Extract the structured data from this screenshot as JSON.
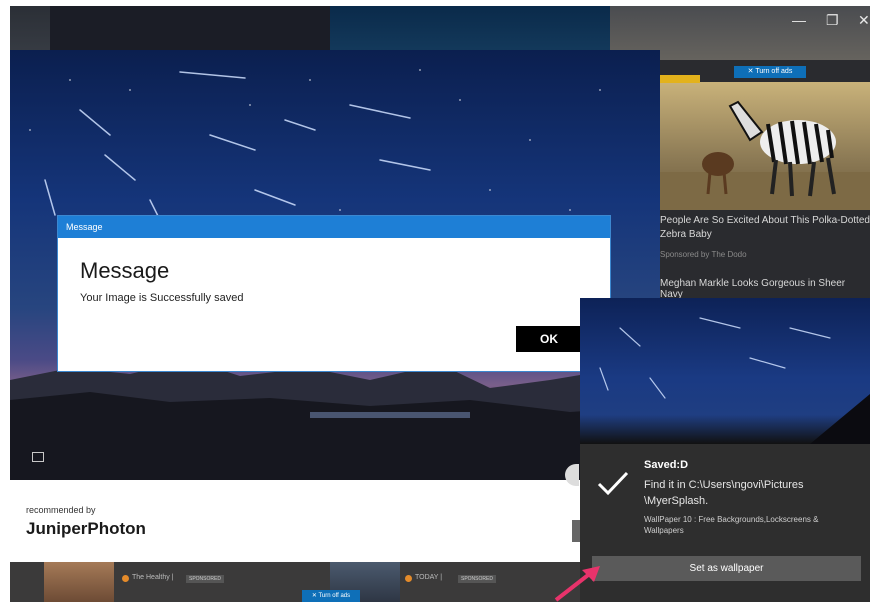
{
  "window": {
    "minimize_glyph": "—",
    "restore_glyph": "❐",
    "close_glyph": "✕"
  },
  "ads": {
    "turn_off_label": "✕ Turn off ads",
    "story1_title": "People Are So Excited About This Polka-Dotted Zebra Baby",
    "story1_sponsor": "Sponsored by The Dodo",
    "story2_title": "Meghan Markle Looks Gorgeous in Sheer Navy",
    "bottom_source1": "The Healthy |",
    "bottom_source2": "TODAY |",
    "sponsored_chip": "SPONSORED",
    "bottom_turn_off": "✕ Turn off ads"
  },
  "recommendation": {
    "by_label": "recommended by",
    "brand": "JuniperPhoton"
  },
  "dialog": {
    "bar_title": "Message",
    "heading": "Message",
    "body": "Your Image is Successfully saved",
    "ok_label": "OK"
  },
  "toast": {
    "check_icon": "checkmark-icon",
    "saved_label": "Saved:D",
    "path_text": "Find it in C:\\Users\\ngovi\\Pictures \\MyerSplash.",
    "app_text": "WallPaper 10 : Free Backgrounds,Lockscreens & Wallpapers",
    "button_label": "Set as wallpaper"
  },
  "colors": {
    "accent": "#1e7fd6",
    "annotation_arrow": "#e8336b"
  }
}
